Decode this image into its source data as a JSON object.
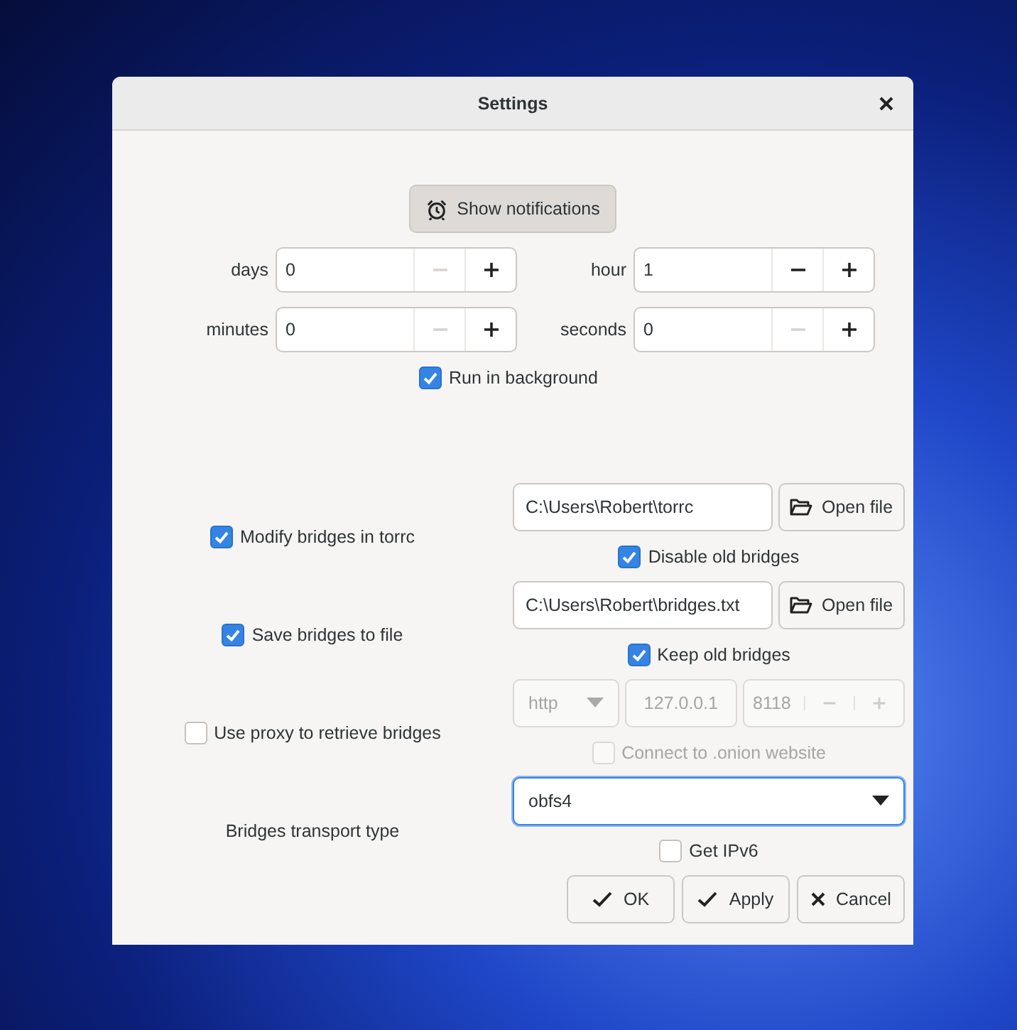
{
  "window": {
    "title": "Settings"
  },
  "notify_button": {
    "label": "Show notifications"
  },
  "timers": [
    {
      "label": "days",
      "value": "0",
      "minus_disabled": true
    },
    {
      "label": "hour",
      "value": "1",
      "minus_disabled": false
    },
    {
      "label": "minutes",
      "value": "0",
      "minus_disabled": true
    },
    {
      "label": "seconds",
      "value": "0",
      "minus_disabled": true
    }
  ],
  "run_in_background": {
    "label": "Run in background",
    "checked": true
  },
  "bridge_groups": [
    {
      "kind": "file",
      "label": "Modify bridges in torrc",
      "checked": true,
      "path": "C:\\Users\\Robert\\torrc",
      "button": "Open file",
      "option": {
        "label": "Disable old bridges",
        "checked": true,
        "disabled": false
      }
    },
    {
      "kind": "file",
      "label": "Save bridges to file",
      "checked": true,
      "path": "C:\\Users\\Robert\\bridges.txt",
      "button": "Open file",
      "option": {
        "label": "Keep old bridges",
        "checked": true,
        "disabled": false
      }
    },
    {
      "kind": "proxy",
      "label": "Use proxy to retrieve bridges",
      "checked": false,
      "type": "http",
      "host": "127.0.0.1",
      "port": "8118",
      "disabled": true,
      "option": {
        "label": "Connect to .onion website",
        "checked": false,
        "disabled": true
      }
    },
    {
      "kind": "select",
      "label": "Bridges transport type",
      "value": "obfs4",
      "option": {
        "label": "Get IPv6",
        "checked": false,
        "disabled": false
      }
    }
  ],
  "buttons": [
    {
      "label": "OK",
      "kind": "check"
    },
    {
      "label": "Apply",
      "kind": "check"
    },
    {
      "label": "Cancel",
      "kind": "cross"
    }
  ]
}
